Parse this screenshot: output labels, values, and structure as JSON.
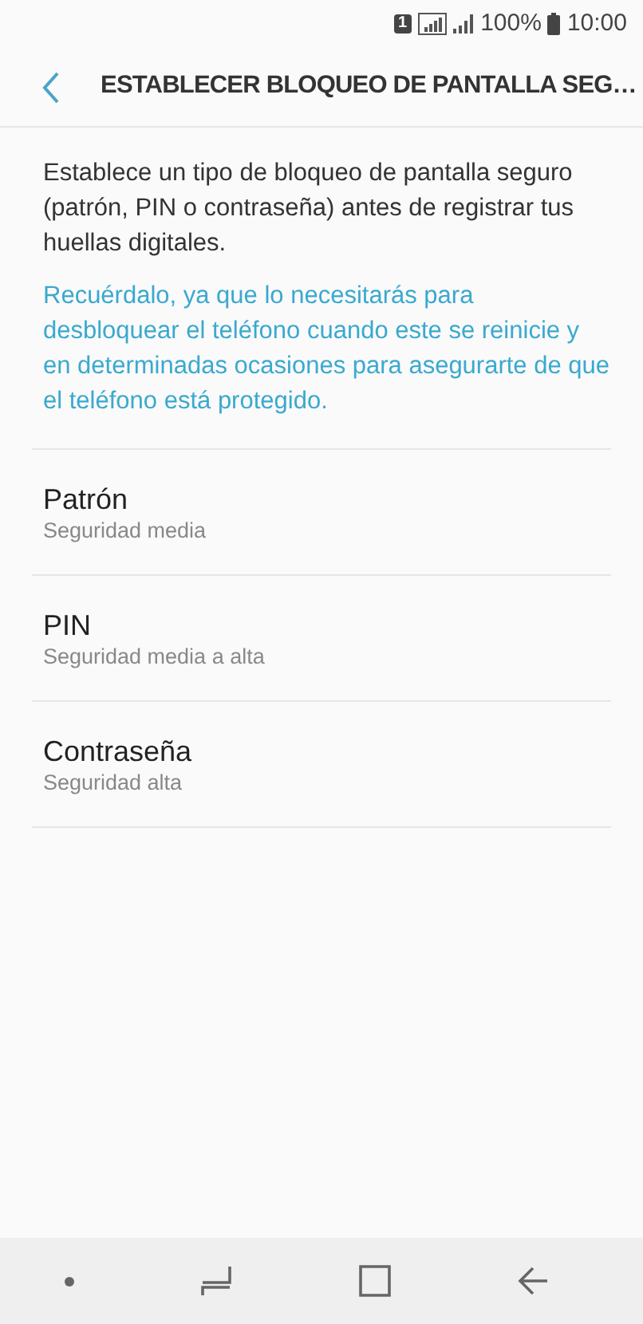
{
  "status_bar": {
    "sim_label": "1",
    "battery_text": "100%",
    "time": "10:00"
  },
  "header": {
    "title": "ESTABLECER BLOQUEO DE PANTALLA SEG…"
  },
  "description": "Establece un tipo de bloqueo de pantalla seguro (patrón, PIN o contraseña) antes de registrar tus huellas digitales.",
  "note": "Recuérdalo, ya que lo necesitarás para desbloquear el teléfono cuando este se reinicie y en determinadas ocasiones para asegurarte de que el teléfono está protegido.",
  "options": [
    {
      "title": "Patrón",
      "subtitle": "Seguridad media"
    },
    {
      "title": "PIN",
      "subtitle": "Seguridad media a alta"
    },
    {
      "title": "Contraseña",
      "subtitle": "Seguridad alta"
    }
  ]
}
